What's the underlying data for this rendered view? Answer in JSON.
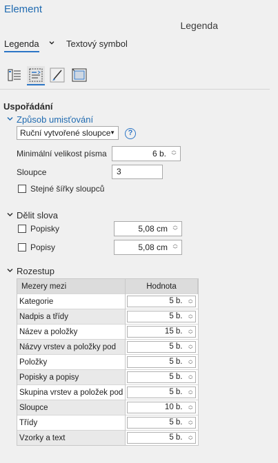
{
  "pane": {
    "title": "Element",
    "subtitle": "Legenda"
  },
  "tabs": {
    "active": "Legenda",
    "other": "Textový symbol"
  },
  "toolbar_icons": [
    "legend-items-icon",
    "arrangement-icon",
    "symbol-brush-icon",
    "frame-display-icon"
  ],
  "section": {
    "title": "Uspořádání"
  },
  "placement": {
    "header": "Způsob umisťování",
    "mode_value": "Ruční vytvořené sloupce",
    "min_font_label": "Minimální velikost písma",
    "min_font_value": "6 b.",
    "columns_label": "Sloupce",
    "columns_value": "3",
    "equal_width_label": "Stejné šířky sloupců"
  },
  "split": {
    "header": "Dělit slova",
    "rows": [
      {
        "label": "Popisky",
        "value": "5,08 cm"
      },
      {
        "label": "Popisy",
        "value": "5,08 cm"
      }
    ]
  },
  "spacing": {
    "header": "Rozestup",
    "columns": [
      "Mezery mezi",
      "Hodnota"
    ],
    "rows": [
      {
        "name": "Kategorie",
        "value": "5 b."
      },
      {
        "name": "Nadpis a třídy",
        "value": "5 b."
      },
      {
        "name": "Název a položky",
        "value": "15 b."
      },
      {
        "name": "Názvy vrstev a položky pod",
        "value": "5 b."
      },
      {
        "name": "Položky",
        "value": "5 b."
      },
      {
        "name": "Popisky a popisy",
        "value": "5 b."
      },
      {
        "name": "Skupina vrstev a položek pod",
        "value": "5 b."
      },
      {
        "name": "Sloupce",
        "value": "10 b."
      },
      {
        "name": "Třídy",
        "value": "5 b."
      },
      {
        "name": "Vzorky a text",
        "value": "5 b."
      }
    ]
  },
  "colors": {
    "accent": "#2b75c6",
    "title": "#1f6ab0",
    "background": "#f0f0f0"
  }
}
